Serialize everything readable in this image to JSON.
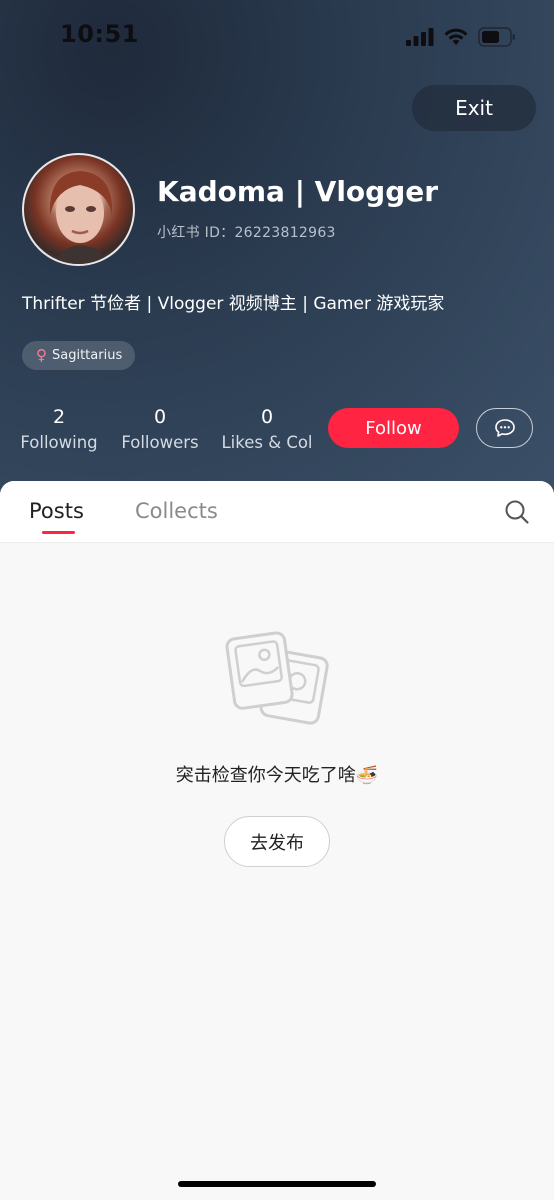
{
  "status_bar": {
    "time": "10:51",
    "icons": [
      "signal-icon",
      "wifi-icon",
      "battery-icon"
    ]
  },
  "header": {
    "exit_label": "Exit",
    "name": "Kadoma | Vlogger",
    "id_text": "小红书 ID：26223812963",
    "bio": "Thrifter 节俭者 | Vlogger 视频博主 | Gamer 游戏玩家",
    "tag": {
      "icon": "female-icon",
      "label": "Sagittarius"
    }
  },
  "stats": [
    {
      "value": "2",
      "label": "Following"
    },
    {
      "value": "0",
      "label": "Followers"
    },
    {
      "value": "0",
      "label": "Likes & Col"
    }
  ],
  "actions": {
    "follow_label": "Follow",
    "message_icon": "chat-bubble-icon"
  },
  "tabs": [
    {
      "label": "Posts",
      "active": true
    },
    {
      "label": "Collects",
      "active": false
    }
  ],
  "empty_state": {
    "icon": "image-placeholder-icon",
    "message": "突击检查你今天吃了啥🍜",
    "button_label": "去发布"
  },
  "colors": {
    "accent": "#ff2442",
    "header_bg": "#2c3d52"
  }
}
